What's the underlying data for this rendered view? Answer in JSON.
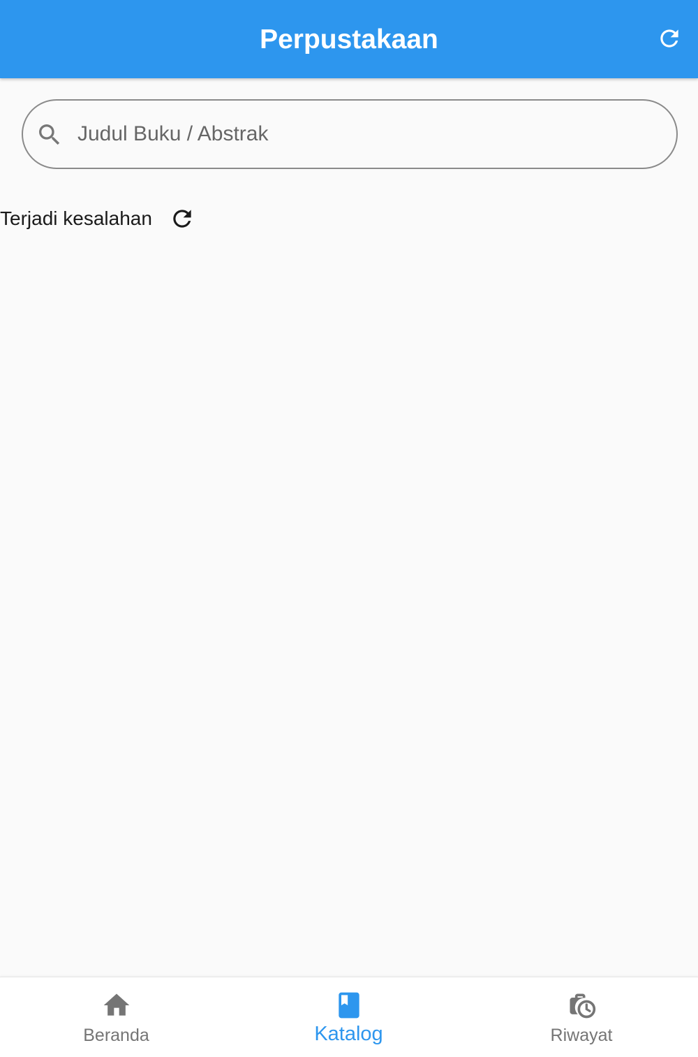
{
  "app_bar": {
    "title": "Perpustakaan",
    "refresh_icon": "refresh-icon",
    "background_color": "#2d96ee"
  },
  "search": {
    "placeholder": "Judul Buku / Abstrak",
    "value": "",
    "icon": "search-icon"
  },
  "error": {
    "message": "Terjadi kesalahan",
    "retry_icon": "refresh-icon"
  },
  "bottom_nav": {
    "active_color": "#2d96ee",
    "inactive_color": "#757575",
    "items": [
      {
        "label": "Beranda",
        "icon": "home-icon",
        "active": false
      },
      {
        "label": "Katalog",
        "icon": "book-icon",
        "active": true
      },
      {
        "label": "Riwayat",
        "icon": "history-icon",
        "active": false
      }
    ]
  }
}
